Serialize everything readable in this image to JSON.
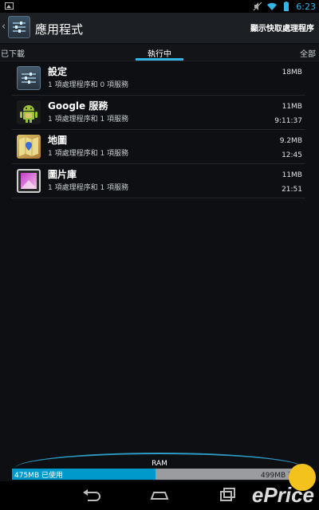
{
  "status_bar": {
    "time": "6:23"
  },
  "action_bar": {
    "title": "應用程式",
    "action_label": "顯示快取處理程序"
  },
  "tabs": {
    "left": "已下載",
    "center": "執行中",
    "right": "全部"
  },
  "apps": [
    {
      "name": "設定",
      "summary": "1 項處理程序和 0 項服務",
      "size": "18MB",
      "time": "",
      "icon": "settings-icon"
    },
    {
      "name": "Google 服務",
      "summary": "1 項處理程序和 1 項服務",
      "size": "11MB",
      "time": "9:11:37",
      "icon": "android-icon"
    },
    {
      "name": "地圖",
      "summary": "1 項處理程序和 1 項服務",
      "size": "9.2MB",
      "time": "12:45",
      "icon": "maps-icon"
    },
    {
      "name": "圖片庫",
      "summary": "1 項處理程序和 1 項服務",
      "size": "11MB",
      "time": "21:51",
      "icon": "gallery-icon"
    }
  ],
  "ram": {
    "label": "RAM",
    "used_text": "475MB 已使用",
    "free_text": "499MB 可用",
    "used_fraction": 0.488
  },
  "watermark": {
    "text": "ePrice"
  },
  "colors": {
    "accent": "#33b5e5",
    "ram_used": "#0099cc",
    "background": "#0d0f12"
  }
}
